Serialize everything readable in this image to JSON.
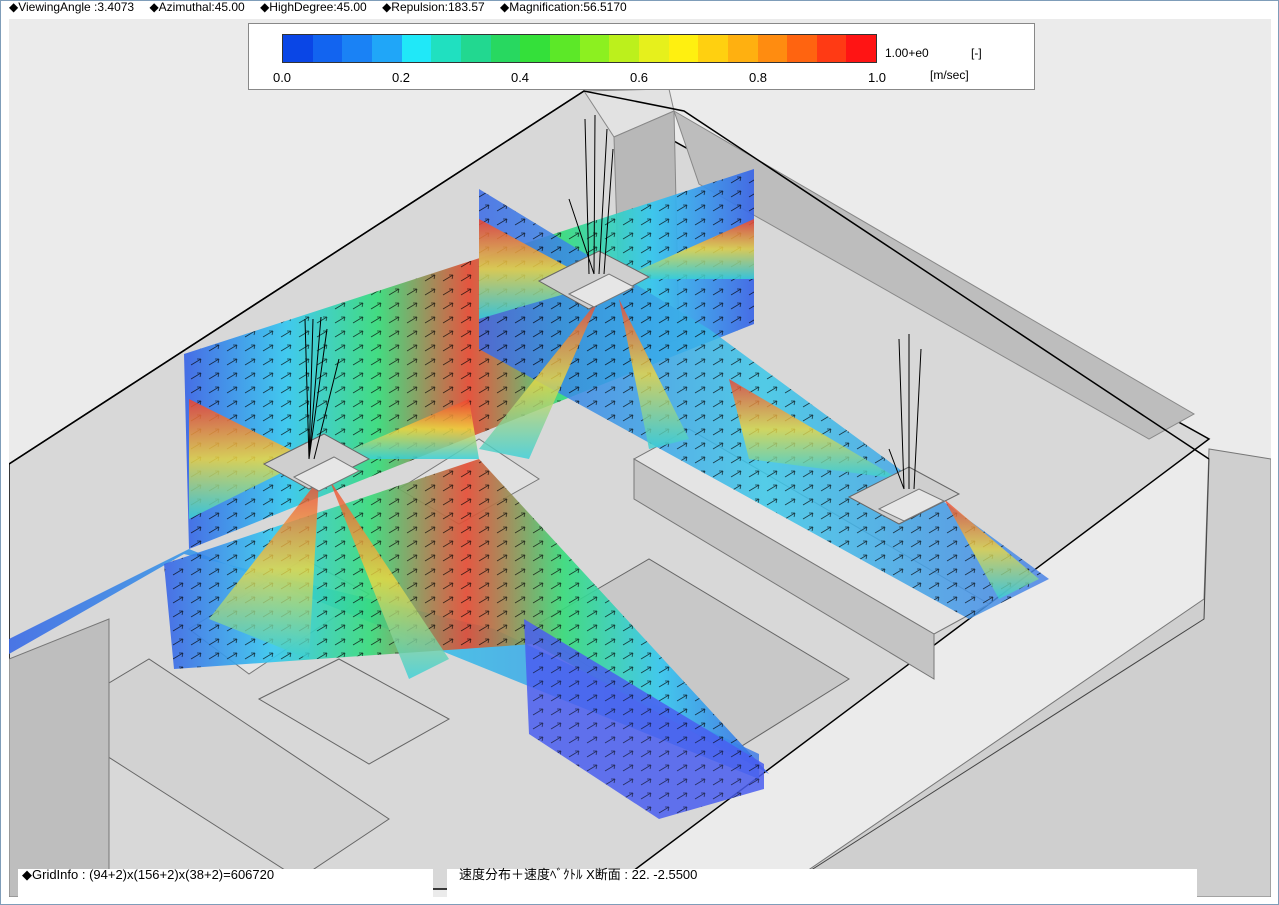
{
  "status": {
    "viewing_angle": "◆ViewingAngle :3.4073",
    "azimuthal": "◆Azimuthal:45.00",
    "high_degree": "◆HighDegree:45.00",
    "repulsion": "◆Repulsion:183.57",
    "magnification": "◆Magnification:56.5170"
  },
  "legend": {
    "colors": [
      "#0a46e6",
      "#1264f0",
      "#1a82f5",
      "#20a6f8",
      "#20e8f8",
      "#20e0c0",
      "#22d890",
      "#28d860",
      "#34e03a",
      "#5ce828",
      "#8cf020",
      "#bcf01c",
      "#e6f01c",
      "#fff010",
      "#ffd010",
      "#ffb010",
      "#ff8c10",
      "#ff6410",
      "#ff3a14",
      "#ff1414"
    ],
    "ticks": [
      "0.0",
      "0.2",
      "0.4",
      "0.6",
      "0.8",
      "1.0"
    ],
    "max_label": "1.00+e0",
    "unit_bracket": "[-]",
    "unit_velocity": "[m/sec]"
  },
  "footer": {
    "grid_info": "◆GridInfo : (94+2)x(156+2)x(38+2)=606720",
    "section_info": "速度分布＋速度ﾍﾞｸﾄﾙ X断面 : 22.  -2.5500"
  }
}
